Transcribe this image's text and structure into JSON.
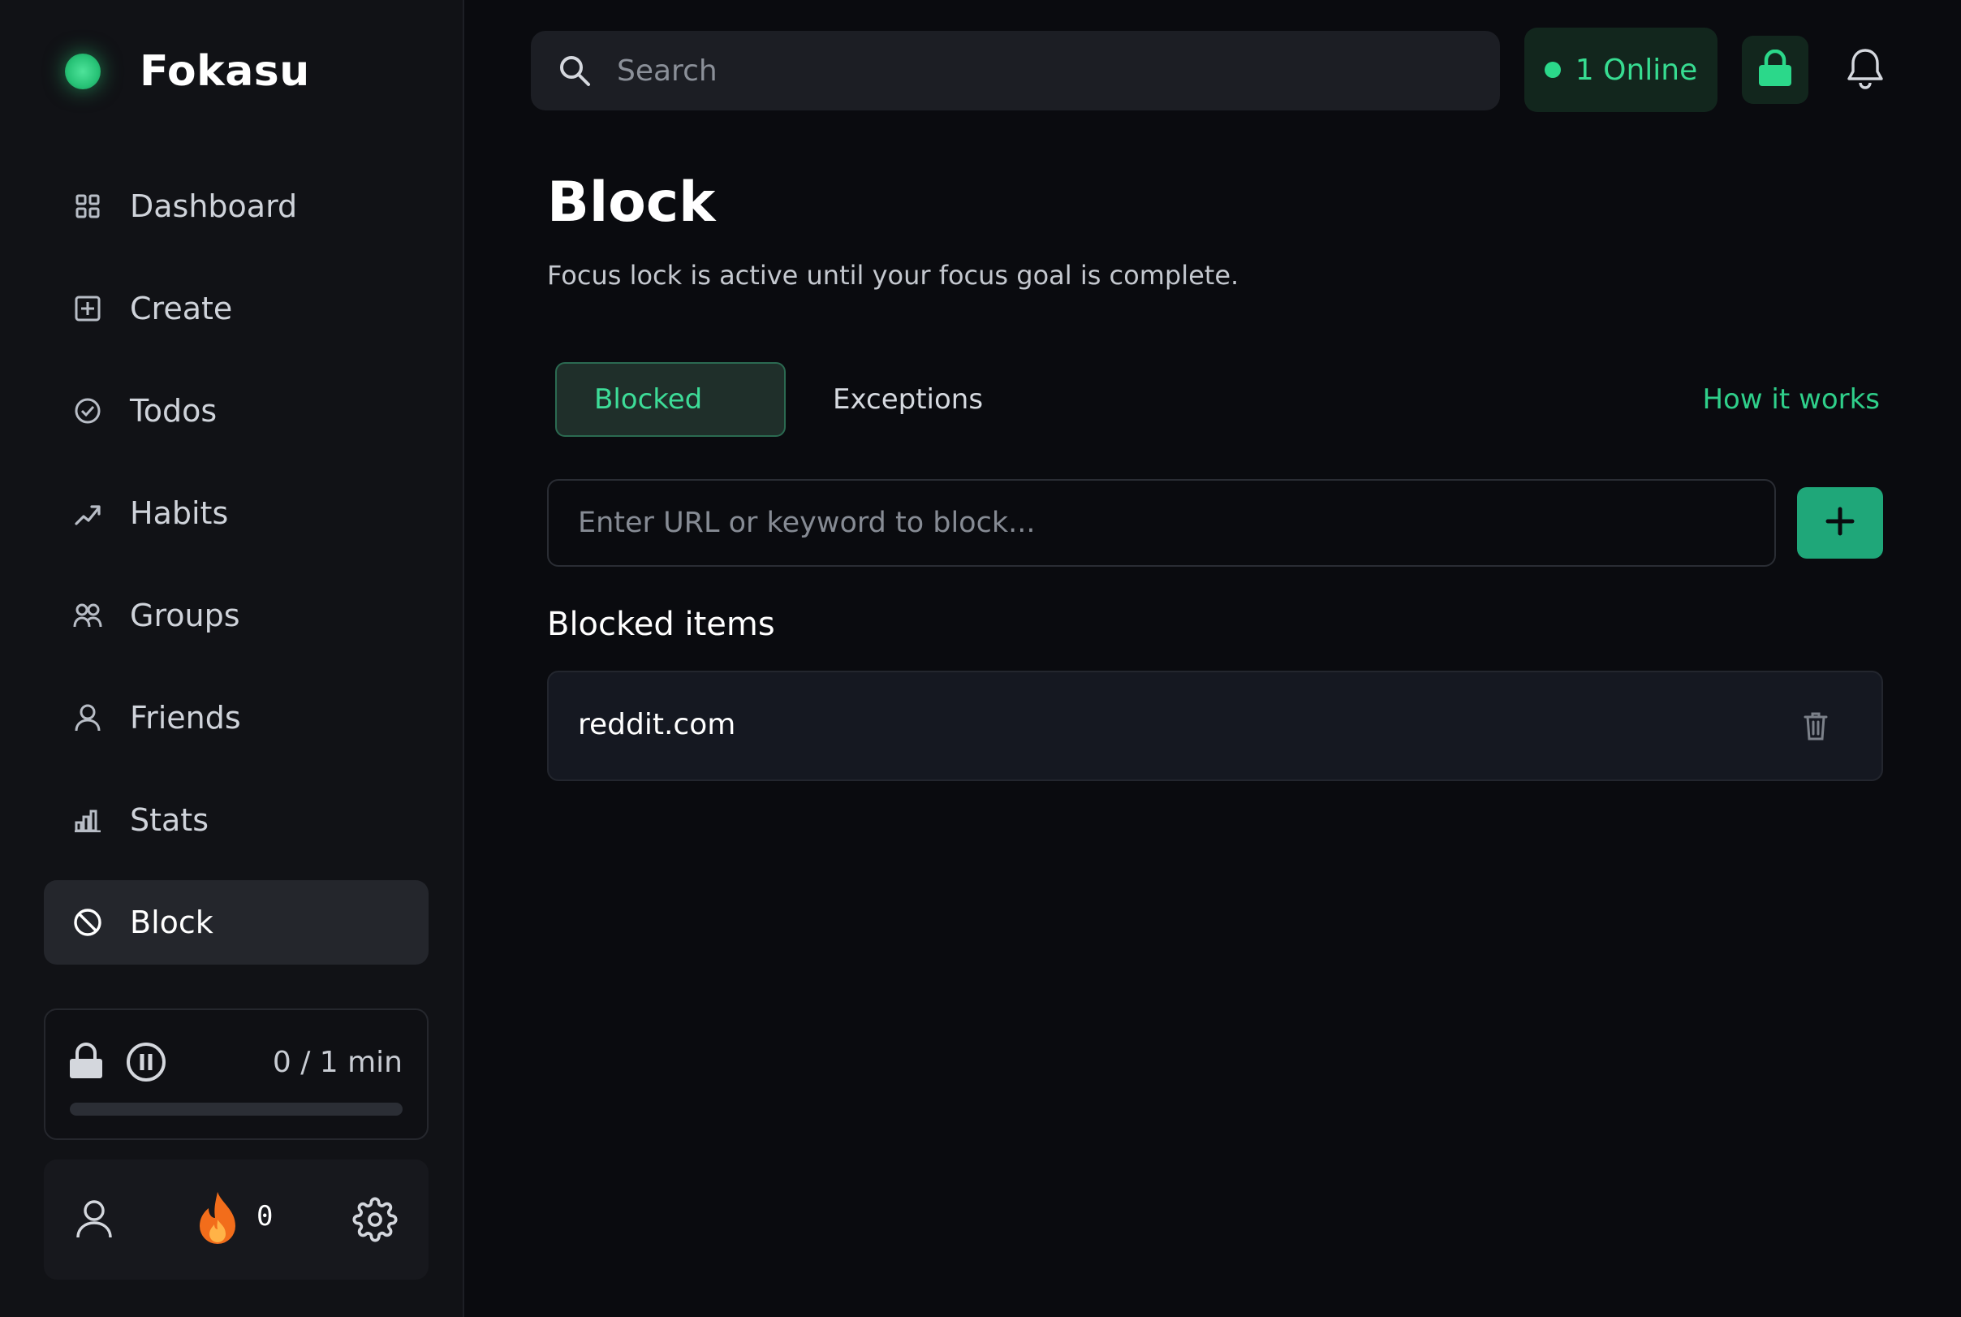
{
  "app": {
    "name": "Fokasu",
    "brand_color": "#2bd88a"
  },
  "sidebar": {
    "items": [
      {
        "label": "Dashboard",
        "icon": "grid-icon"
      },
      {
        "label": "Create",
        "icon": "plus-square-icon"
      },
      {
        "label": "Todos",
        "icon": "check-circle-icon"
      },
      {
        "label": "Habits",
        "icon": "trend-icon"
      },
      {
        "label": "Groups",
        "icon": "group-icon"
      },
      {
        "label": "Friends",
        "icon": "user-icon"
      },
      {
        "label": "Stats",
        "icon": "bar-chart-icon"
      },
      {
        "label": "Block",
        "icon": "block-icon",
        "active": true
      }
    ],
    "focus": {
      "time_text": "0 / 1 min",
      "progress": 0
    },
    "footer": {
      "streak": "0"
    }
  },
  "header": {
    "search_placeholder": "Search",
    "online_text": "1 Online"
  },
  "main": {
    "title": "Block",
    "subtitle": "Focus lock is active until your focus goal is complete.",
    "tabs": [
      {
        "label": "Blocked",
        "active": true
      },
      {
        "label": "Exceptions",
        "active": false
      }
    ],
    "how_it_works": "How it works",
    "input_placeholder": "Enter URL or keyword to block...",
    "blocked_title": "Blocked items",
    "blocked_items": [
      {
        "domain": "reddit.com"
      }
    ]
  }
}
